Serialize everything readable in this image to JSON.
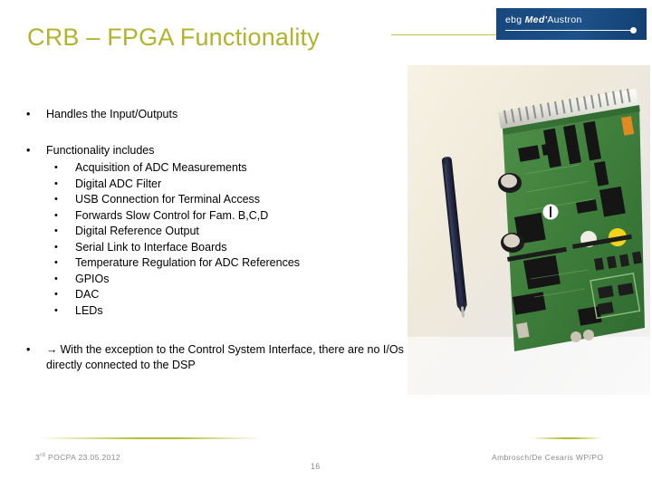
{
  "slide": {
    "title": "CRB – FPGA Functionality",
    "title_color": "#b2b32c",
    "background_color": "#ffffff"
  },
  "logo": {
    "prefix": "ebg ",
    "italic_part": "Med'",
    "suffix": "Austron",
    "box_color": "#1a4a80",
    "text_color": "#ffffff"
  },
  "content": {
    "bullets": [
      {
        "marker": "•",
        "text": "Handles the Input/Outputs",
        "level": 1
      },
      {
        "marker": "•",
        "text": "Functionality includes",
        "level": 1
      }
    ],
    "sub_bullets": [
      {
        "marker": "•",
        "text": "Acquisition of ADC Measurements"
      },
      {
        "marker": "•",
        "text": "Digital ADC Filter"
      },
      {
        "marker": "•",
        "text": "USB Connection for Terminal Access"
      },
      {
        "marker": "•",
        "text": "Forwards Slow Control for Fam. B,C,D"
      },
      {
        "marker": "•",
        "text": "Digital Reference Output"
      },
      {
        "marker": "•",
        "text": "Serial Link to Interface Boards"
      },
      {
        "marker": "•",
        "text": "Temperature Regulation for ADC References"
      },
      {
        "marker": "•",
        "text": "GPIOs"
      },
      {
        "marker": "•",
        "text": "DAC"
      },
      {
        "marker": "•",
        "text": "LEDs"
      }
    ],
    "conclusion": {
      "marker": "•",
      "arrow": "→",
      "text": "With the exception to the Control System Interface, there are no I/Os directly connected to the DSP"
    }
  },
  "photo": {
    "alt": "photograph of a green printed circuit board with connector header and a dark blue pen lying beside it on a light surface"
  },
  "footer": {
    "left_ordinal": "3",
    "left_ordinal_suffix": "rd",
    "left_text": " POCPA 23.05.2012",
    "page_number": "16",
    "right_text": "Ambrosch/De Cesaris WP/PO",
    "rule_color": "#b9bc32"
  }
}
